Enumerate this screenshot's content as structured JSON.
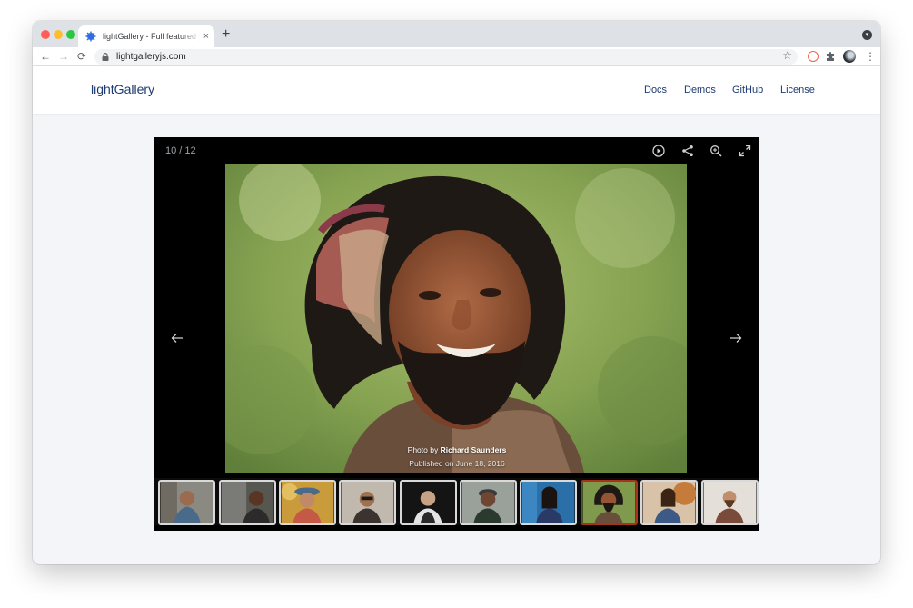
{
  "browser": {
    "tab_title": "lightGallery - Full featured javascript image & video gallery",
    "tab_close": "×",
    "new_tab": "+",
    "url": "lightgalleryjs.com",
    "back": "←",
    "forward": "→",
    "reload": "⟳",
    "star": "☆",
    "menu": "⋮"
  },
  "site": {
    "brand": "lightGallery",
    "nav": [
      "Docs",
      "Demos",
      "GitHub",
      "License"
    ]
  },
  "gallery": {
    "counter": "10 / 12",
    "caption_prefix": "Photo by",
    "caption_author": "Richard Saunders",
    "caption_date": "Published on June 18, 2016",
    "thumbnails": [
      {
        "subject": "boy-portrait",
        "active": false
      },
      {
        "subject": "woman-portrait",
        "active": false
      },
      {
        "subject": "woman-hat-portrait",
        "active": false
      },
      {
        "subject": "woman-sunglasses-portrait",
        "active": false
      },
      {
        "subject": "man-dark-background-portrait",
        "active": false
      },
      {
        "subject": "man-cap-portrait",
        "active": false
      },
      {
        "subject": "woman-blue-wall-portrait",
        "active": false
      },
      {
        "subject": "bearded-man-portrait",
        "active": true
      },
      {
        "subject": "woman-autumn-portrait",
        "active": false
      },
      {
        "subject": "bearded-man-plaid-portrait",
        "active": false
      }
    ]
  },
  "colors": {
    "brand": "#1e3a72",
    "active_thumb_border": "#a8321a",
    "gallery_bg": "#000000"
  }
}
